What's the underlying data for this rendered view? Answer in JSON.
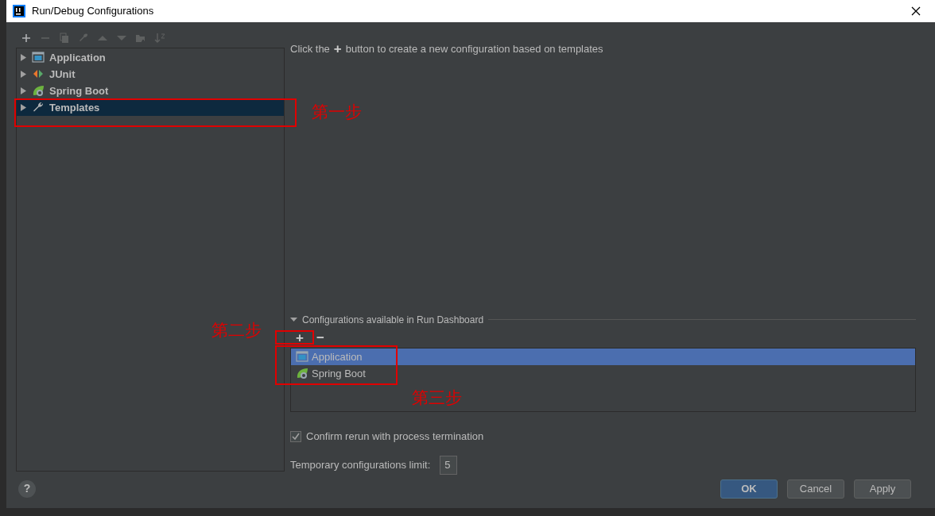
{
  "window": {
    "title": "Run/Debug Configurations"
  },
  "toolbar": [
    {
      "kind": "add",
      "disabled": false
    },
    {
      "kind": "remove",
      "disabled": true
    },
    {
      "kind": "copy",
      "disabled": true
    },
    {
      "kind": "edit",
      "disabled": true
    },
    {
      "kind": "up",
      "disabled": true
    },
    {
      "kind": "down",
      "disabled": true
    },
    {
      "kind": "folder",
      "disabled": true
    },
    {
      "kind": "sort",
      "disabled": true
    }
  ],
  "tree": {
    "items": [
      {
        "label": "Application",
        "kind": "application",
        "selected": false,
        "expanded": false
      },
      {
        "label": "JUnit",
        "kind": "junit",
        "selected": false,
        "expanded": false
      },
      {
        "label": "Spring Boot",
        "kind": "spring",
        "selected": false,
        "expanded": false
      },
      {
        "label": "Templates",
        "kind": "templates",
        "selected": true,
        "expanded": false
      }
    ]
  },
  "hint": {
    "before": "Click the",
    "icon": "+",
    "after": "button to create a new configuration based on templates"
  },
  "dashboard": {
    "title": "Configurations available in Run Dashboard",
    "expanded": true,
    "add": "+",
    "remove": "−",
    "items": [
      {
        "label": "Application",
        "kind": "application",
        "selected": true
      },
      {
        "label": "Spring Boot",
        "kind": "spring",
        "selected": false
      }
    ]
  },
  "confirm_rerun": {
    "label": "Confirm rerun with process termination",
    "checked": true
  },
  "temp_limit": {
    "label": "Temporary configurations limit:",
    "value": "5"
  },
  "help": "?",
  "buttons": [
    {
      "label": "OK",
      "primary": true
    },
    {
      "label": "Cancel",
      "primary": false
    },
    {
      "label": "Apply",
      "primary": false
    }
  ],
  "annotations": [
    {
      "label": "第一步"
    },
    {
      "label": "第二步"
    },
    {
      "label": "第三步"
    }
  ]
}
